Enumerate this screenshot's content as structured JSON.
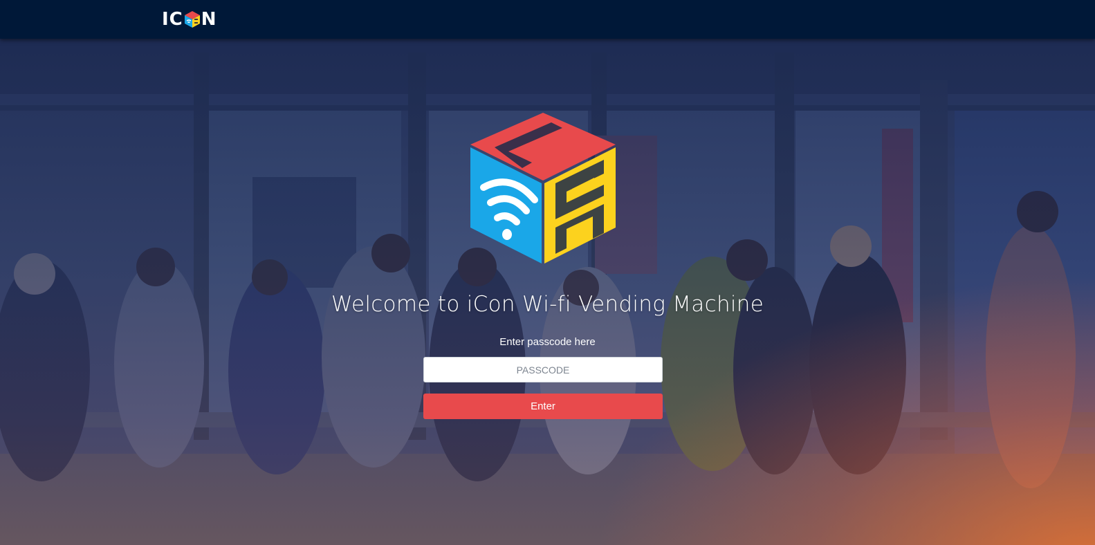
{
  "navbar": {
    "logo_text_left": "IC",
    "logo_text_right": "N"
  },
  "hero": {
    "welcome_text": "Welcome to iCon Wi-fi Vending Machine",
    "passcode_label": "Enter passcode here",
    "passcode_placeholder": "PASSCODE",
    "passcode_value": "",
    "enter_button_label": "Enter"
  },
  "colors": {
    "navbar_bg": "#001838",
    "button_red": "#e84a4c",
    "cube_red": "#e84a4c",
    "cube_blue": "#1aa7e8",
    "cube_yellow": "#fcd21e"
  },
  "icons": [
    "icon-cube-logo",
    "wifi-icon",
    "nav-cube-icon"
  ]
}
